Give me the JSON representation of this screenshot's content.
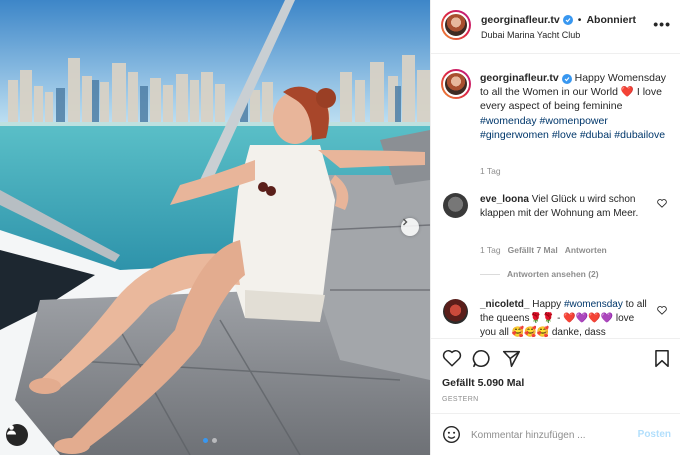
{
  "post": {
    "username": "georginafleur.tv",
    "follow_label": "Abonniert",
    "location": "Dubai Marina Yacht Club",
    "more_label": "•••"
  },
  "caption": {
    "username": "georginafleur.tv",
    "text_part1": "Happy Womensday to all the Women in our World",
    "heart": "❤️",
    "text_part2": "I love every aspect of being feminine",
    "hashtags": [
      "#womenday",
      "#womenpower",
      "#gingerwomen",
      "#love",
      "#dubai",
      "#dubailove"
    ],
    "time": "1 Tag"
  },
  "comments": [
    {
      "username": "eve_loona",
      "text": "Viel Glück u wird schon klappen mit der Wohnung am Meer.",
      "time": "1 Tag",
      "likes": "Gefällt 7 Mal",
      "reply_label": "Antworten",
      "view_replies": "Antworten ansehen (2)"
    },
    {
      "username": "_nicoletd_",
      "text_part1": "Happy",
      "hashtag": "#womensday",
      "text_part2": "to all the queens🌹🌹 - ❤️💜❤️💜 love you all 🥰🥰🥰 danke, dass"
    }
  ],
  "actions": {
    "likes": "Gefällt 5.090 Mal",
    "date": "GESTERN"
  },
  "add_comment": {
    "placeholder": "Kommentar hinzufügen ...",
    "post_label": "Posten"
  },
  "icons": {
    "verified": "verified-badge-icon",
    "next": "chevron-right-icon",
    "tag": "user-tag-icon",
    "like": "heart-icon",
    "comment": "comment-icon",
    "share": "share-icon",
    "save": "bookmark-icon",
    "emoji": "emoji-icon"
  },
  "colors": {
    "link": "#00376b",
    "accent": "#3897f0",
    "post_disabled": "#b2dffc",
    "heart": "#ed4956"
  }
}
